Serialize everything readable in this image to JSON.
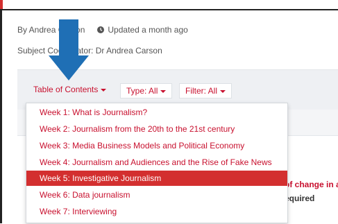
{
  "meta": {
    "author": "By Andrea Carson",
    "updated": "Updated a month ago",
    "clock_icon": "clock-icon"
  },
  "subject": {
    "text": "Subject Coordinator: Dr Andrea Carson"
  },
  "toolbar": {
    "toc_label": "Table of Contents",
    "type_label": "Type: All",
    "filter_label": "Filter: All"
  },
  "dropdown": {
    "items": [
      "Week 1: What is Journalism?",
      "Week 2: Journalism from the 20th to the 21st century",
      "Week 3: Media Business Models and Political Economy",
      "Week 4: Journalism and Audiences and the Rise of Fake News",
      "Week 5: Investigative Journalism",
      "Week 6: Data journalism",
      "Week 7: Interviewing"
    ],
    "active_index": 4
  },
  "background": {
    "line1": "of change in a",
    "line2": "equired"
  },
  "colors": {
    "accent": "#c8102e",
    "active_bg": "#d32f2f",
    "arrow": "#1f6fb5"
  }
}
